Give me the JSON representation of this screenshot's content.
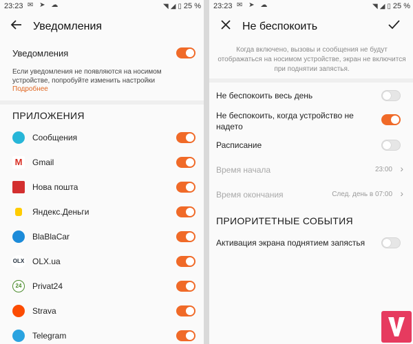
{
  "status": {
    "time": "23:23",
    "battery": "25 %"
  },
  "left": {
    "title": "Уведомления",
    "notifications_label": "Уведомления",
    "hint": "Если уведомления не появляются на носимом устройстве, попробуйте изменить настройки",
    "more_link": "Подробнее",
    "section": "ПРИЛОЖЕНИЯ",
    "apps": [
      {
        "name": "Сообщения",
        "icon": "messages-icon",
        "color": "#27b6d8",
        "letter": ""
      },
      {
        "name": "Gmail",
        "icon": "gmail-icon",
        "color": "#ffffff",
        "letter": "M"
      },
      {
        "name": "Нова пошта",
        "icon": "nova-poshta-icon",
        "color": "#d32f2f",
        "letter": ""
      },
      {
        "name": "Яндекс.Деньги",
        "icon": "yandex-money-icon",
        "color": "#ffffff",
        "letter": ""
      },
      {
        "name": "BlaBlaCar",
        "icon": "blablacar-icon",
        "color": "#1c8bd9",
        "letter": ""
      },
      {
        "name": "OLX.ua",
        "icon": "olx-icon",
        "color": "#ffffff",
        "letter": "OLX"
      },
      {
        "name": "Privat24",
        "icon": "privat24-icon",
        "color": "#ffffff",
        "letter": "24"
      },
      {
        "name": "Strava",
        "icon": "strava-icon",
        "color": "#fc4c02",
        "letter": ""
      },
      {
        "name": "Telegram",
        "icon": "telegram-icon",
        "color": "#2aa3e0",
        "letter": ""
      }
    ]
  },
  "right": {
    "title": "Не беспокоить",
    "description": "Когда включено, вызовы и сообщения не будут отображаться на носимом устройстве, экран не включится при поднятии запястья.",
    "rows": {
      "all_day": "Не беспокоить весь день",
      "not_worn": "Не беспокоить, когда устройство не надето",
      "schedule": "Расписание",
      "start_label": "Время начала",
      "start_value": "23:00",
      "end_label": "Время окончания",
      "end_value": "След. день в 07:00"
    },
    "section": "ПРИОРИТЕТНЫЕ СОБЫТИЯ",
    "wrist_label": "Активация экрана поднятием запястья"
  },
  "colors": {
    "accent": "#f06a28",
    "link": "#e0651f",
    "watermark": "#e63b5f"
  }
}
